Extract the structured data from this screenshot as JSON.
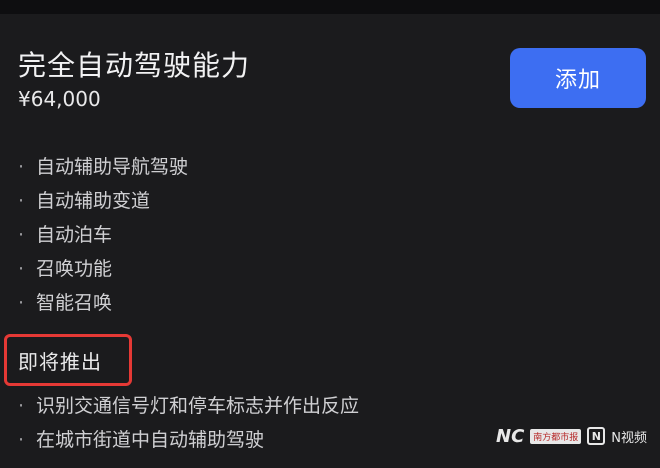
{
  "product": {
    "title": "完全自动驾驶能力",
    "price": "¥64,000",
    "add_label": "添加"
  },
  "features": [
    "自动辅助导航驾驶",
    "自动辅助变道",
    "自动泊车",
    "召唤功能",
    "智能召唤"
  ],
  "bullet": "·",
  "upcoming": {
    "label": "即将推出",
    "highlight_color": "#e53935",
    "items": [
      "识别交通信号灯和停车标志并作出反应",
      "在城市街道中自动辅助驾驶"
    ]
  },
  "watermark": {
    "logo_text": "NC",
    "badge_text": "南方都市报",
    "video_label": "N视频",
    "icon": "n-video-icon"
  },
  "colors": {
    "background": "#1b1b1d",
    "accent": "#3d6ef2"
  }
}
